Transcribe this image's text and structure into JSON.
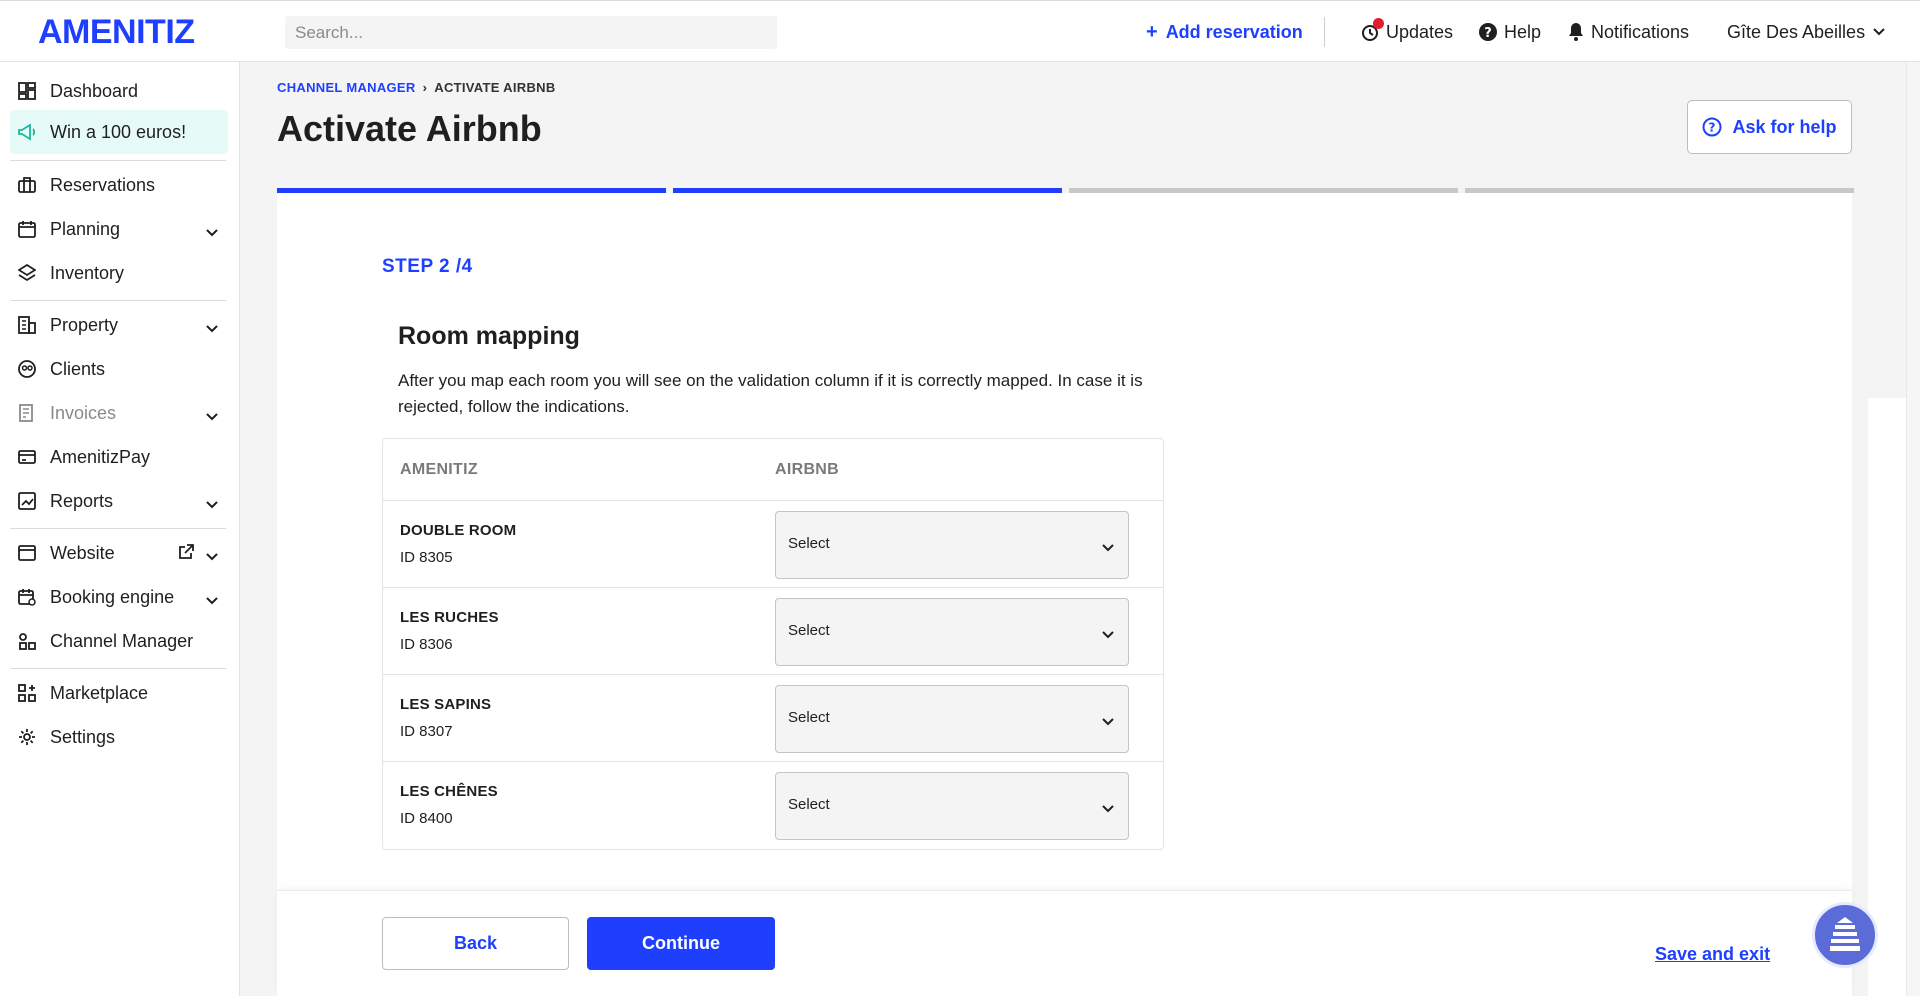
{
  "app": {
    "logo": "AMENITIZ"
  },
  "topbar": {
    "search_placeholder": "Search...",
    "add_reservation": "Add reservation",
    "updates": "Updates",
    "help": "Help",
    "notifications": "Notifications",
    "property_name": "Gîte Des Abeilles"
  },
  "sidebar": {
    "items": [
      {
        "label": "Dashboard",
        "icon": "dashboard-icon"
      },
      {
        "label": "Win a 100 euros!",
        "icon": "megaphone-icon"
      },
      {
        "label": "Reservations",
        "icon": "suitcase-icon"
      },
      {
        "label": "Planning",
        "icon": "calendar-icon"
      },
      {
        "label": "Inventory",
        "icon": "layers-icon"
      },
      {
        "label": "Property",
        "icon": "building-icon"
      },
      {
        "label": "Clients",
        "icon": "clients-icon"
      },
      {
        "label": "Invoices",
        "icon": "invoice-icon"
      },
      {
        "label": "AmenitizPay",
        "icon": "card-icon"
      },
      {
        "label": "Reports",
        "icon": "chart-icon"
      },
      {
        "label": "Website",
        "icon": "browser-icon"
      },
      {
        "label": "Booking engine",
        "icon": "calendar-check-icon"
      },
      {
        "label": "Channel Manager",
        "icon": "channel-icon"
      },
      {
        "label": "Marketplace",
        "icon": "grid-plus-icon"
      },
      {
        "label": "Settings",
        "icon": "gear-icon"
      }
    ]
  },
  "page": {
    "breadcrumb_parent": "CHANNEL MANAGER",
    "breadcrumb_current": "ACTIVATE AIRBNB",
    "title": "Activate Airbnb",
    "ask_help": "Ask for help",
    "progress": {
      "current_step": 2,
      "total_steps": 4
    },
    "step_label": "STEP 2 /4",
    "section_title": "Room mapping",
    "section_desc": "After you map each room you will see on the validation column if it is correctly mapped. In case it is rejected, follow the indications."
  },
  "mapping_table": {
    "headers": [
      "AMENITIZ",
      "AIRBNB"
    ],
    "rows": [
      {
        "name": "DOUBLE ROOM",
        "id": "ID 8305",
        "select": "Select"
      },
      {
        "name": "LES RUCHES",
        "id": "ID 8306",
        "select": "Select"
      },
      {
        "name": "LES SAPINS",
        "id": "ID 8307",
        "select": "Select"
      },
      {
        "name": "LES CHÊNES",
        "id": "ID 8400",
        "select": "Select"
      }
    ]
  },
  "footer": {
    "back": "Back",
    "continue": "Continue",
    "save_exit": "Save and exit"
  },
  "colors": {
    "accent": "#1f3fff",
    "promo_bg": "#e6fbf7",
    "badge": "#e01e2e"
  }
}
